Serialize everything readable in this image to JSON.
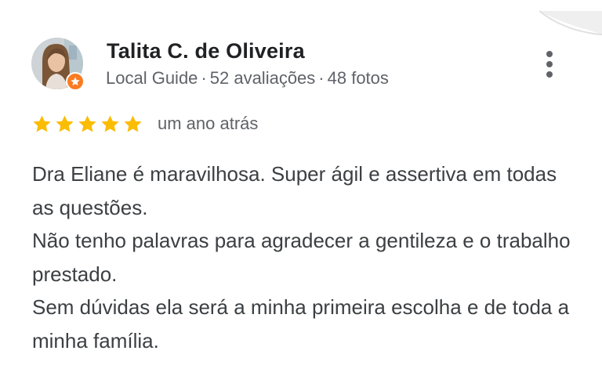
{
  "review": {
    "reviewer_name": "Talita C. de Oliveira",
    "meta": {
      "badge": "Local Guide",
      "reviews_count": "52 avaliações",
      "photos_count": "48 fotos",
      "separator": "·"
    },
    "rating": 5,
    "rating_max": 5,
    "time_ago": "um ano atrás",
    "text_paragraphs": [
      "Dra Eliane é maravilhosa. Super ágil e assertiva em todas as questões.",
      "Não tenho palavras para agradecer a gentileza e o trabalho prestado.",
      "Sem dúvidas ela será a minha primeira escolha e de toda a minha família."
    ]
  },
  "icons": {
    "avatar": "reviewer-avatar",
    "badge": "local-guide-star-icon",
    "more": "more-vert-icon",
    "star": "star-icon"
  },
  "colors": {
    "star": "#fbbc04",
    "badge": "#f97b22",
    "name": "#202124",
    "meta": "#5f6368",
    "body_text": "#3c4043"
  }
}
